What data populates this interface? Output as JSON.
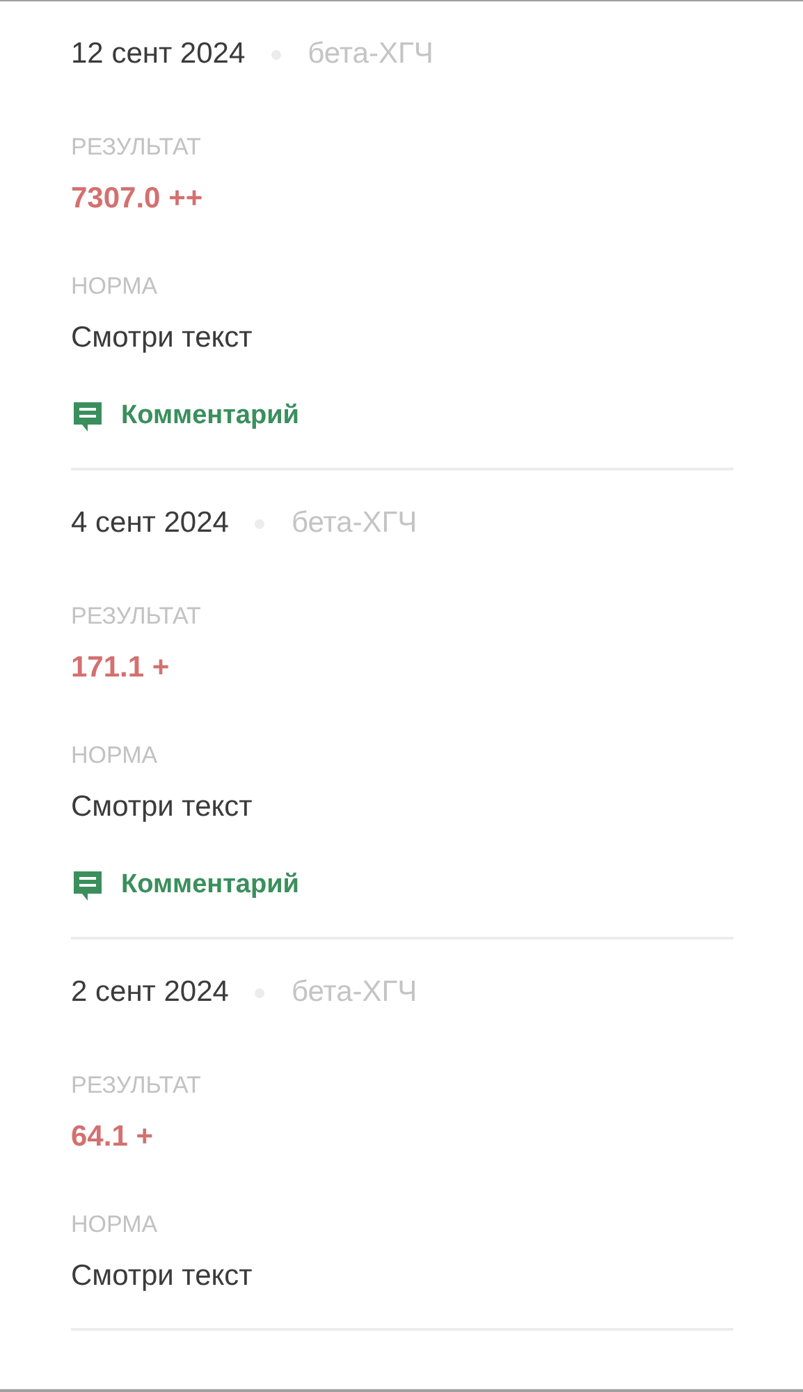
{
  "entries": [
    {
      "date": "12 сент 2024",
      "lab": "бета-ХГЧ",
      "result_label": "РЕЗУЛЬТАТ",
      "result": "7307.0 ++",
      "norm_label": "НОРМА",
      "norm": "Смотри текст",
      "comment": "Комментарий"
    },
    {
      "date": "4 сент 2024",
      "lab": "бета-ХГЧ",
      "result_label": "РЕЗУЛЬТАТ",
      "result": "171.1 +",
      "norm_label": "НОРМА",
      "norm": "Смотри текст",
      "comment": "Комментарий"
    },
    {
      "date": "2 сент 2024",
      "lab": "бета-ХГЧ",
      "result_label": "РЕЗУЛЬТАТ",
      "result": "64.1 +",
      "norm_label": "НОРМА",
      "norm": "Смотри текст"
    }
  ]
}
